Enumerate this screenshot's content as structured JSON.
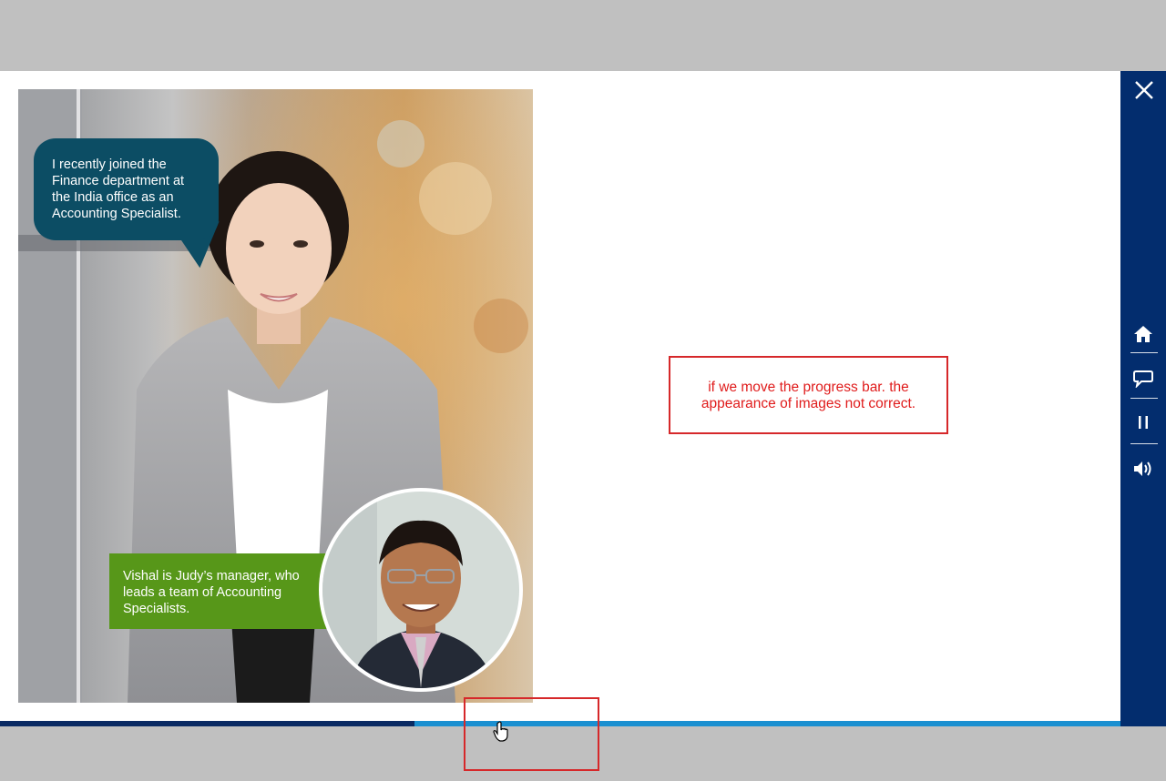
{
  "scene": {
    "speech_bubble": "I recently joined the Finance department at the India office as an Accounting Specialist.",
    "caption": "Vishal is Judy’s manager, who leads a team of Accounting Specialists."
  },
  "annotation": {
    "line1": "if we move the progress bar. the",
    "line2": "appearance of images not correct."
  },
  "controls": {
    "close": "close-icon",
    "home": "home-icon",
    "transcript": "speech-bubble-icon",
    "pause": "pause-icon",
    "volume": "volume-icon"
  },
  "progress": {
    "fraction": 0.37
  },
  "colors": {
    "sidebar": "#032d6e",
    "bubble": "#0c4d64",
    "caption_bg": "#579719",
    "progress_fill": "#0a2a63",
    "progress_track": "#1a8fd0",
    "annotation": "#d6282a"
  }
}
